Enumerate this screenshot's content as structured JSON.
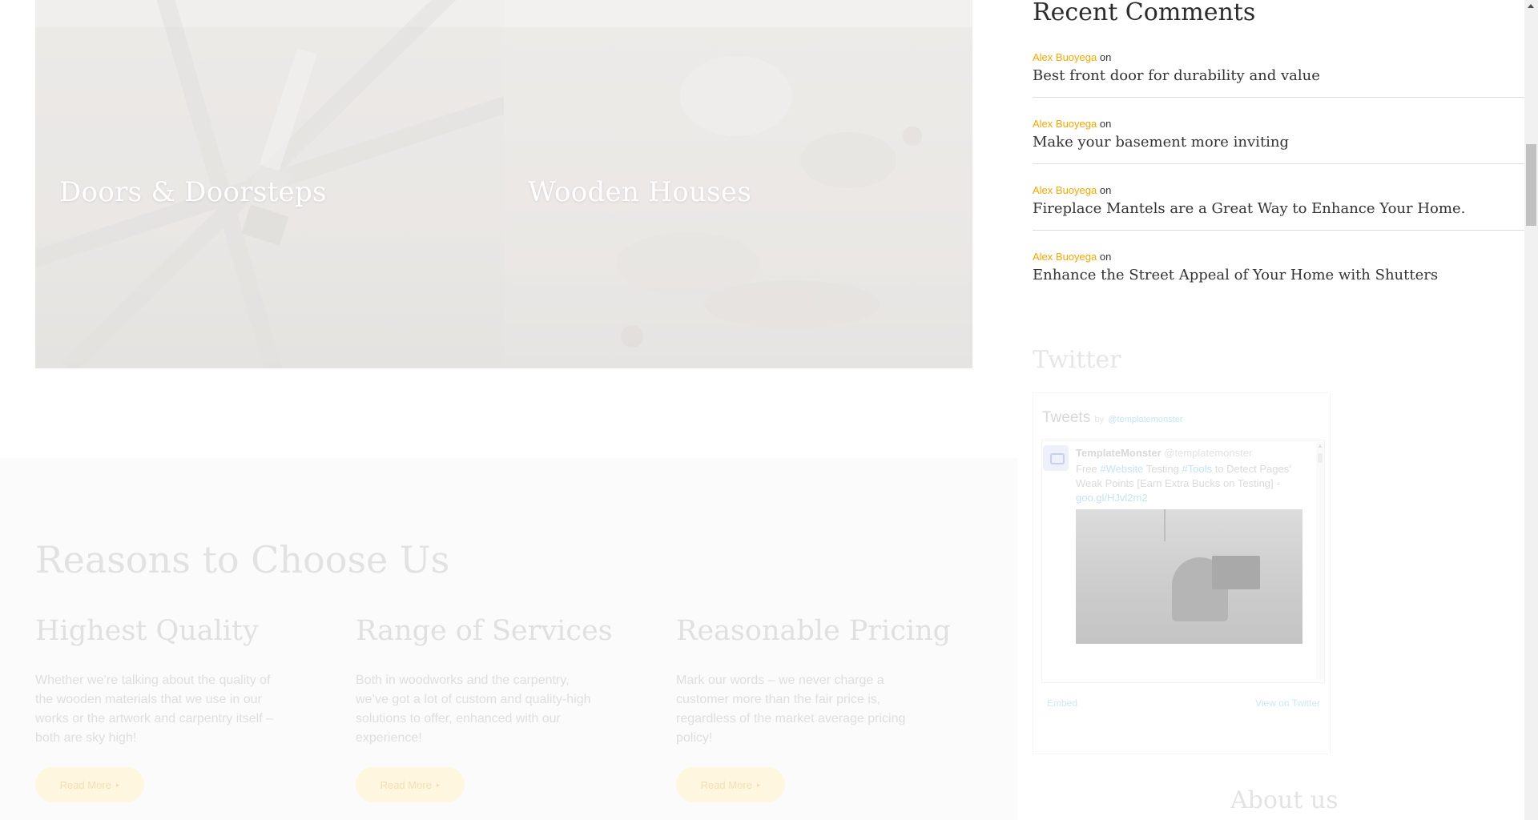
{
  "tiles": [
    {
      "title": "Doors & Doorsteps"
    },
    {
      "title": "Wooden Houses"
    }
  ],
  "reasons": {
    "heading": "Reasons to Choose Us",
    "items": [
      {
        "title": "Highest Quality",
        "text": "Whether we’re talking about the quality of the wooden materials that we use in our works or the artwork and carpentry itself – both are sky high!",
        "button": "Read More"
      },
      {
        "title": "Range of Services",
        "text": "Both in woodworks and the carpentry, we’ve got a lot of custom and quality-high solutions to offer, enhanced with our experience!",
        "button": "Read More"
      },
      {
        "title": "Reasonable Pricing",
        "text": "Mark our words – we never charge a customer more than the fair price is, regardless of the market average pricing policy!",
        "button": "Read More"
      }
    ]
  },
  "sidebar": {
    "recent_comments": {
      "title": "Recent Comments",
      "items": [
        {
          "author": "Alex Buoyega",
          "on": "on",
          "post": "Best front door for durability and value"
        },
        {
          "author": "Alex Buoyega",
          "on": "on",
          "post": "Make your basement more inviting"
        },
        {
          "author": "Alex Buoyega",
          "on": "on",
          "post": "Fireplace Mantels are a Great Way to Enhance Your Home."
        },
        {
          "author": "Alex Buoyega",
          "on": "on",
          "post": "Enhance the Street Appeal of Your Home with Shutters"
        }
      ]
    },
    "twitter": {
      "title": "Twitter",
      "header": "Tweets",
      "by": "by",
      "handle": "@templatemonster",
      "tweet": {
        "name": "TemplateMonster",
        "screen_name": "@templatemonster",
        "text_1": "Free ",
        "hashtag_1": "#Website",
        "text_2": " Testing ",
        "hashtag_2": "#Tools",
        "text_3": " to Detect Pages' Weak Points [Earn Extra Bucks on Testing] - ",
        "link": "goo.gl/HJvl2m2"
      },
      "embed": "Embed",
      "view_on": "View on Twitter"
    },
    "about": {
      "title": "About us"
    }
  },
  "colors": {
    "accent": "#f5a700",
    "tile_title": "#ffffff",
    "button_bg": "#fff6e0"
  }
}
